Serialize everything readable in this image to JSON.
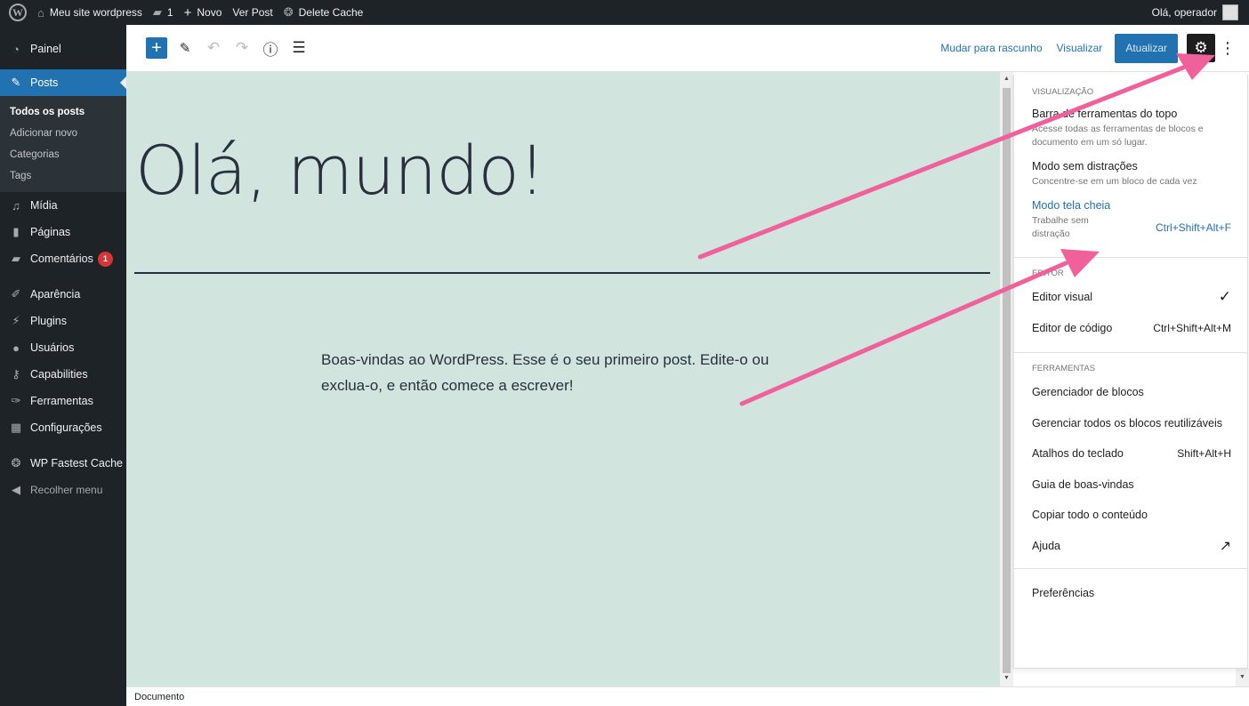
{
  "admin_bar": {
    "site_name": "Meu site wordpress",
    "comments_count": "1",
    "new_label": "Novo",
    "view_post_label": "Ver Post",
    "delete_cache_label": "Delete Cache",
    "greeting": "Olá, operador"
  },
  "sidebar": {
    "painel": "Painel",
    "posts": "Posts",
    "posts_submenu": [
      "Todos os posts",
      "Adicionar novo",
      "Categorias",
      "Tags"
    ],
    "midia": "Mídia",
    "paginas": "Páginas",
    "comentarios": "Comentários",
    "comentarios_badge": "1",
    "aparencia": "Aparência",
    "plugins": "Plugins",
    "usuarios": "Usuários",
    "capabilities": "Capabilities",
    "ferramentas": "Ferramentas",
    "configuracoes": "Configurações",
    "wp_fastest_cache": "WP Fastest Cache",
    "recolher_menu": "Recolher menu"
  },
  "toolbar": {
    "switch_draft": "Mudar para rascunho",
    "preview": "Visualizar",
    "update": "Atualizar"
  },
  "post": {
    "title": "Olá, mundo!",
    "body": "Boas-vindas ao WordPress. Esse é o seu primeiro post. Edite-o ou exclua-o, e então comece a escrever!"
  },
  "dropdown": {
    "view_heading": "Visualização",
    "top_toolbar_label": "Barra de ferramentas do topo",
    "top_toolbar_desc": "Acesse todas as ferramentas de blocos e documento em um só lugar.",
    "distraction_free_label": "Modo sem distrações",
    "distraction_free_desc": "Concentre-se em um bloco de cada vez",
    "fullscreen_label": "Modo tela cheia",
    "fullscreen_desc": "Trabalhe sem distração",
    "fullscreen_shortcut": "Ctrl+Shift+Alt+F",
    "editor_heading": "Editor",
    "visual_editor": "Editor visual",
    "code_editor": "Editor de código",
    "code_editor_shortcut": "Ctrl+Shift+Alt+M",
    "tools_heading": "Ferramentas",
    "block_manager": "Gerenciador de blocos",
    "manage_reusable": "Gerenciar todos os blocos reutilizáveis",
    "keyboard_shortcuts": "Atalhos do teclado",
    "keyboard_shortcuts_shortcut": "Shift+Alt+H",
    "welcome_guide": "Guia de boas-vindas",
    "copy_all": "Copiar todo o conteúdo",
    "help": "Ajuda",
    "preferences": "Preferências"
  },
  "footer": {
    "breadcrumb": "Documento"
  },
  "colors": {
    "admin_dark": "#1d2327",
    "wp_blue": "#2271b1",
    "canvas_bg": "#d1e4dd",
    "annotation_arrow": "#f0609a"
  }
}
